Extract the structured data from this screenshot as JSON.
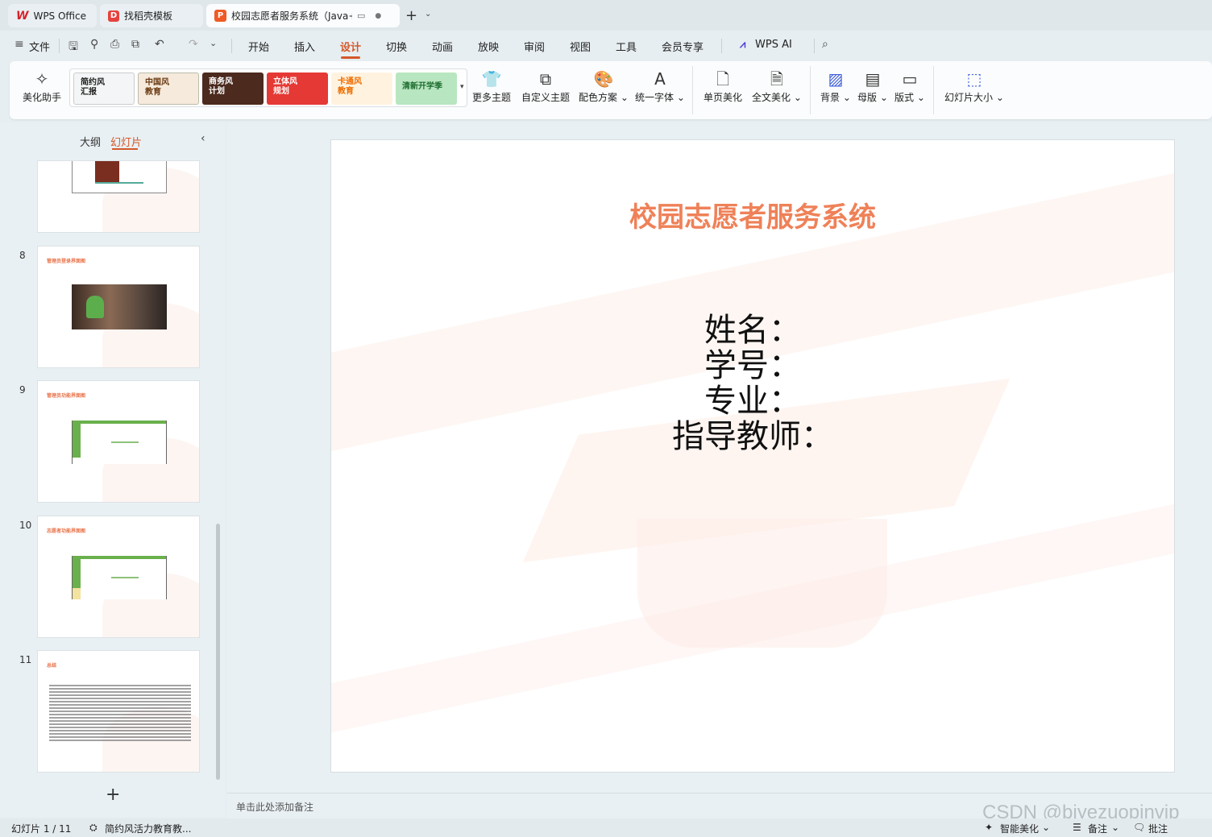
{
  "tabs": [
    {
      "label": "WPS Office"
    },
    {
      "label": "找稻壳模板"
    },
    {
      "label": "校园志愿者服务系统（Java+"
    }
  ],
  "menu": {
    "file": "文件",
    "items": [
      "开始",
      "插入",
      "设计",
      "切换",
      "动画",
      "放映",
      "审阅",
      "视图",
      "工具",
      "会员专享"
    ],
    "active": "设计",
    "wps_ai": "WPS AI"
  },
  "ribbon": {
    "beautify": "美化助手",
    "themes": [
      "简约风\n汇报",
      "中国风\n教育",
      "商务风\n计划",
      "立体风\n规划",
      "卡通风\n教育",
      "清新开学季"
    ],
    "more_themes": "更多主题",
    "custom_theme": "自定义主题",
    "color_scheme": "配色方案",
    "unify_font": "统一字体",
    "single_page": "单页美化",
    "full_text": "全文美化",
    "background": "背景",
    "master": "母版",
    "layout": "版式",
    "slide_size": "幻灯片大小"
  },
  "left_panel": {
    "tab_outline": "大纲",
    "tab_slides": "幻灯片",
    "thumbnails": [
      {
        "num": "",
        "title": ""
      },
      {
        "num": "8",
        "title": "管理员登录界面图"
      },
      {
        "num": "9",
        "title": "管理员功能界面图"
      },
      {
        "num": "10",
        "title": "志愿者功能界面图"
      },
      {
        "num": "11",
        "title": "总结"
      }
    ]
  },
  "slide": {
    "title": "校园志愿者服务系统",
    "fields": [
      "姓名：",
      "学号：",
      "专业：",
      "指导教师："
    ]
  },
  "notes_placeholder": "单击此处添加备注",
  "status": {
    "slide_counter": "幻灯片 1 / 11",
    "theme_name": "简约风活力教育教...",
    "smart_beautify": "智能美化",
    "notes": "备注",
    "comments": "批注"
  },
  "watermark": "CSDN @biyezuopinvip",
  "colors": {
    "accent": "#d4582a",
    "slide_title": "#ef8158"
  }
}
